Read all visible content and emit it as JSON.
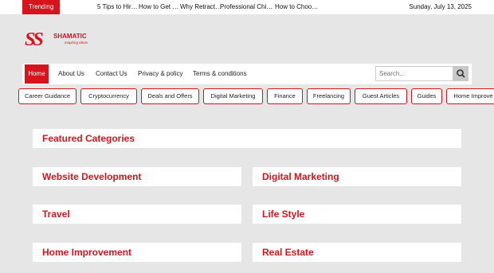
{
  "topbar": {
    "trending_label": "Trending",
    "items": [
      "5 Tips to Hir…",
      "How to Get …",
      "Why Retract…",
      "Professional Chi…",
      "How to Choo…"
    ],
    "date": "Sunday, July 13, 2025"
  },
  "logo": {
    "mark": "SS",
    "name": "SHAMATIC",
    "tagline": "Inspiring ideas"
  },
  "nav": {
    "items": [
      "Home",
      "About Us",
      "Contact Us",
      "Privacy & policy",
      "Terms & conditions"
    ],
    "search_placeholder": "Search..."
  },
  "categories": [
    "Career Guidance",
    "Cryptocurrency",
    "Deals and Offers",
    "Digital Marketing",
    "Finance",
    "Freelancing",
    "Guest Articles",
    "Guides",
    "Home Improve"
  ],
  "featured": {
    "title": "Featured Categories",
    "cards": [
      "Website Development",
      "Digital Marketing",
      "Travel",
      "Life Style",
      "Home Improvement",
      "Real Estate"
    ]
  },
  "colors": {
    "accent": "#d7131c",
    "background": "#e6e6e6"
  }
}
